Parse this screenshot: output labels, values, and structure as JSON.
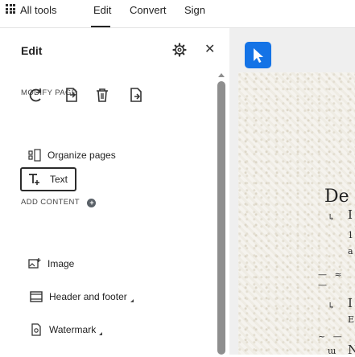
{
  "menubar": {
    "items": [
      "All tools",
      "Edit",
      "Convert",
      "Sign"
    ],
    "active": "Edit"
  },
  "panel": {
    "title": "Edit",
    "modify_label": "MODIFY PAGE",
    "organize_label": "Organize pages",
    "add_content_label": "ADD CONTENT",
    "text_label": "Text",
    "image_label": "Image",
    "header_footer_label": "Header and footer",
    "watermark_label": "Watermark"
  },
  "page": {
    "heading": "De",
    "fragments": [
      "I",
      "I",
      "N"
    ],
    "small": [
      "1",
      "a",
      "E"
    ]
  },
  "colors": {
    "accent": "#1473e6",
    "scroll_thumb": "#8e8e8e"
  },
  "icons": [
    "apps-grid-icon",
    "gear-icon",
    "close-icon",
    "rotate-icon",
    "extract-icon",
    "delete-icon",
    "replace-icon",
    "organize-icon",
    "add-circle-icon",
    "text-icon",
    "image-icon",
    "header-footer-icon",
    "watermark-icon",
    "select-pointer-icon"
  ]
}
